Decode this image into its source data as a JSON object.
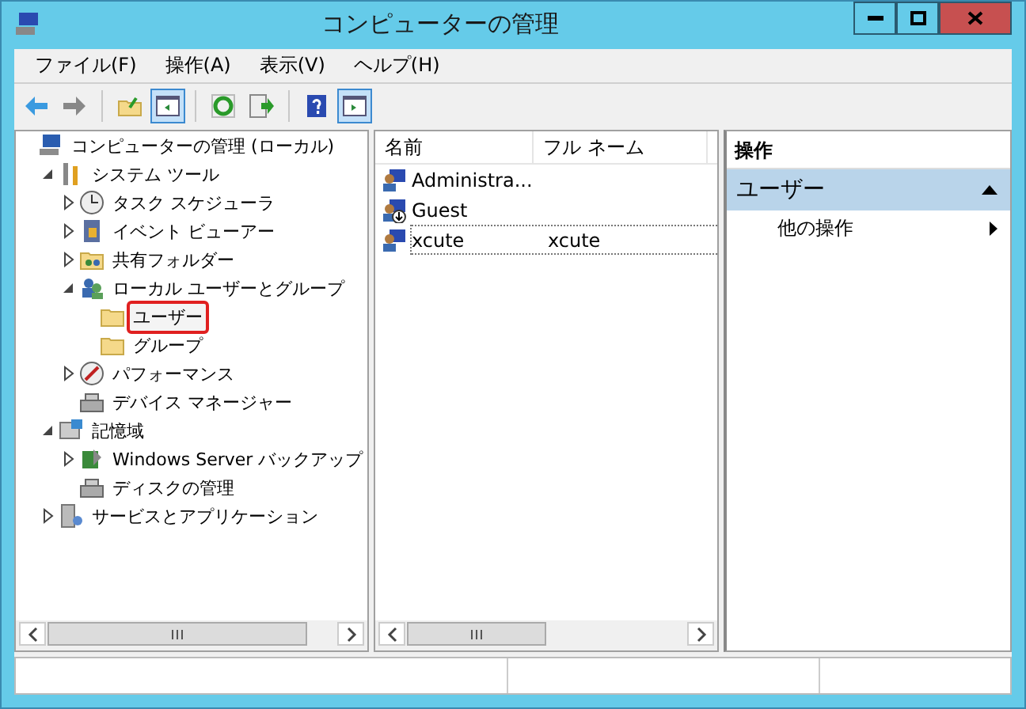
{
  "window": {
    "title": "コンピューターの管理"
  },
  "menu": [
    "ファイル(F)",
    "操作(A)",
    "表示(V)",
    "ヘルプ(H)"
  ],
  "toolbar": [
    [
      {
        "kind": "back",
        "pressed": false
      },
      {
        "kind": "forward",
        "pressed": false
      }
    ],
    [
      {
        "kind": "up",
        "pressed": false
      },
      {
        "kind": "tree",
        "pressed": true
      }
    ],
    [
      {
        "kind": "refresh",
        "pressed": false
      },
      {
        "kind": "export",
        "pressed": false
      }
    ],
    [
      {
        "kind": "help",
        "pressed": false
      },
      {
        "kind": "pane",
        "pressed": true
      }
    ]
  ],
  "tree": [
    {
      "label": "コンピューターの管理 (ローカル)",
      "kind": "computer",
      "selected": false,
      "children": [
        {
          "label": "システム ツール",
          "kind": "tools",
          "expanded": true,
          "selected": false,
          "children": [
            {
              "label": "タスク スケジューラ",
              "kind": "clock",
              "expanded": false,
              "selected": false
            },
            {
              "label": "イベント ビューアー",
              "kind": "log",
              "expanded": false,
              "selected": false
            },
            {
              "label": "共有フォルダー",
              "kind": "share",
              "expanded": false,
              "selected": false
            },
            {
              "label": "ローカル ユーザーとグループ",
              "kind": "users",
              "expanded": true,
              "selected": false,
              "children": [
                {
                  "label": "ユーザー",
                  "kind": "folder",
                  "selected": true
                },
                {
                  "label": "グループ",
                  "kind": "folder",
                  "selected": false
                }
              ]
            },
            {
              "label": "パフォーマンス",
              "kind": "perf",
              "expanded": false,
              "selected": false
            },
            {
              "label": "デバイス マネージャー",
              "kind": "device",
              "selected": false
            }
          ]
        },
        {
          "label": "記憶域",
          "kind": "storage",
          "expanded": true,
          "selected": false,
          "children": [
            {
              "label": "Windows Server バックアップ",
              "kind": "backup",
              "expanded": false,
              "selected": false
            },
            {
              "label": "ディスクの管理",
              "kind": "device",
              "selected": false
            }
          ]
        },
        {
          "label": "サービスとアプリケーション",
          "kind": "services",
          "expanded": false,
          "selected": false
        }
      ]
    }
  ],
  "list": {
    "columns": [
      "名前",
      "フル ネーム"
    ],
    "rows": [
      {
        "name": "Administra...",
        "disabled": false,
        "focused": false
      },
      {
        "name": "Guest",
        "disabled": true,
        "focused": false
      },
      {
        "name": "xcute",
        "full_name": "xcute",
        "disabled": false,
        "focused": true
      }
    ]
  },
  "actions": {
    "header": "操作",
    "sections": [
      {
        "title": "ユーザー",
        "expanded": true,
        "items": [
          {
            "label": "他の操作",
            "submenu": true
          }
        ]
      }
    ]
  }
}
